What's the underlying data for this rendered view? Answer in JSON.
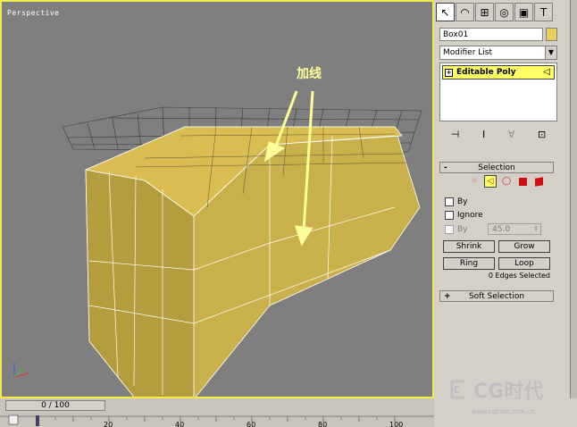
{
  "viewport": {
    "label": "Perspective",
    "annotation": "加线"
  },
  "command_panel": {
    "tabs": [
      {
        "name": "create-tab",
        "glyph": "↖"
      },
      {
        "name": "modify-tab",
        "glyph": "◠"
      },
      {
        "name": "hierarchy-tab",
        "glyph": "⊞"
      },
      {
        "name": "motion-tab",
        "glyph": "◎"
      },
      {
        "name": "display-tab",
        "glyph": "▣"
      },
      {
        "name": "utilities-tab",
        "glyph": "T"
      }
    ],
    "object_name": "Box01",
    "modifier_list": "Modifier List",
    "stack_item": "Editable Poly",
    "tool_glyphs": [
      "⊣",
      "I",
      "∀",
      "⊡"
    ]
  },
  "selection_rollout": {
    "title": "Selection",
    "collapse_symbol": "-",
    "subobjects": [
      "vertex-icon",
      "edge-icon",
      "border-icon",
      "polygon-icon",
      "element-icon"
    ],
    "by_label": "By",
    "ignore_label": "Ignore",
    "by2_label": "By",
    "angle_value": "45.0",
    "buttons": {
      "shrink": "Shrink",
      "grow": "Grow",
      "ring": "Ring",
      "loop": "Loop"
    },
    "status": "0 Edges Selected"
  },
  "soft_selection_rollout": {
    "title": "Soft Selection",
    "expand_symbol": "+"
  },
  "timeline": {
    "frame_display": "0 / 100",
    "ticks": [
      20,
      40,
      60,
      80,
      100
    ]
  },
  "watermark": {
    "text": "CG时代",
    "url": "www.cgtime.com.cn"
  },
  "colors": {
    "viewport_bg": "#7f7f7f",
    "mesh_fill": "#c9b04a",
    "active_border": "#f4ea4a",
    "selection_yellow": "#ffff66"
  }
}
